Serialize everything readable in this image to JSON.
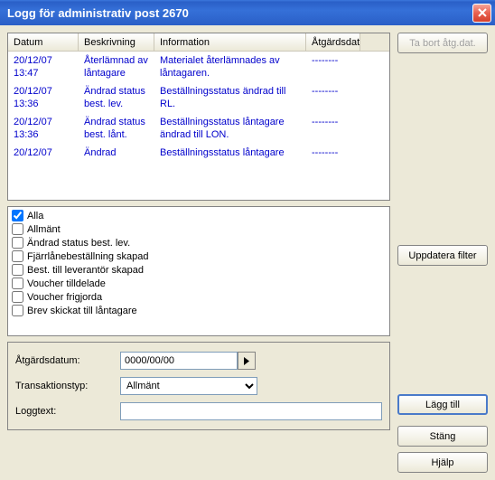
{
  "window": {
    "title": "Logg för administrativ post 2670"
  },
  "table": {
    "headers": {
      "datum": "Datum",
      "besk": "Beskrivning",
      "info": "Information",
      "atg": "Åtgärdsdatu"
    },
    "rows": [
      {
        "datum": "20/12/07 13:47",
        "besk": "Återlämnad av låntagare",
        "info": "Materialet återlämnades av låntagaren.",
        "atg": "--------"
      },
      {
        "datum": "20/12/07 13:36",
        "besk": "Ändrad status best. lev.",
        "info": "Beställningsstatus ändrad till RL.",
        "atg": "--------"
      },
      {
        "datum": "20/12/07 13:36",
        "besk": "Ändrad status best. lånt.",
        "info": "Beställningsstatus låntagare ändrad till LON.",
        "atg": "--------"
      },
      {
        "datum": "20/12/07",
        "besk": "Ändrad",
        "info": "Beställningsstatus låntagare",
        "atg": "--------"
      }
    ]
  },
  "filters": [
    {
      "label": "Alla",
      "checked": true
    },
    {
      "label": "Allmänt",
      "checked": false
    },
    {
      "label": "Ändrad status best. lev.",
      "checked": false
    },
    {
      "label": "Fjärrlånebeställning skapad",
      "checked": false
    },
    {
      "label": "Best. till leverantör skapad",
      "checked": false
    },
    {
      "label": "Voucher tilldelade",
      "checked": false
    },
    {
      "label": "Voucher frigjorda",
      "checked": false
    },
    {
      "label": "Brev skickat till låntagare",
      "checked": false
    }
  ],
  "form": {
    "atg_label": "Åtgärdsdatum:",
    "atg_value": "0000/00/00",
    "trans_label": "Transaktionstyp:",
    "trans_value": "Allmänt",
    "log_label": "Loggtext:",
    "log_value": ""
  },
  "buttons": {
    "remove": "Ta bort åtg.dat.",
    "update_filter": "Uppdatera filter",
    "add": "Lägg till",
    "close": "Stäng",
    "help": "Hjälp"
  }
}
